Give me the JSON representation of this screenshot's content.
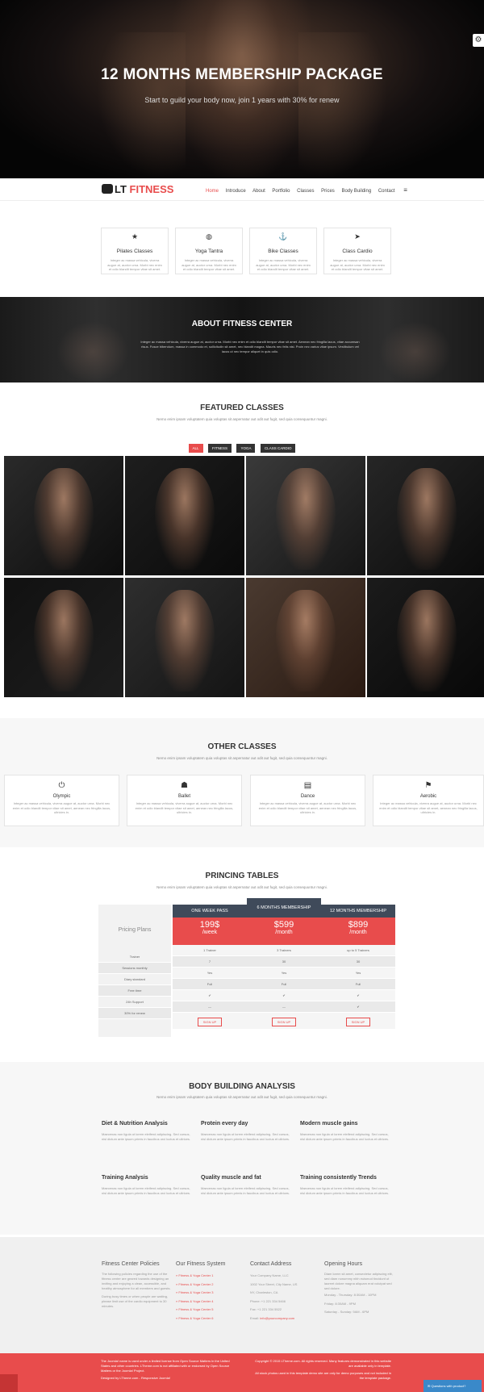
{
  "hero": {
    "title": "12 MONTHS MEMBERSHIP PACKAGE",
    "subtitle": "Start to guild your body now, join 1 years with 30% for renew",
    "gear": "⚙"
  },
  "nav": {
    "logo_prefix": "LT",
    "logo_accent": "FITNESS",
    "items": [
      "Home",
      "Introduce",
      "About",
      "Portfolio",
      "Classes",
      "Prices",
      "Body Building",
      "Contact"
    ],
    "menu_icon": "≡"
  },
  "services": [
    {
      "icon": "★",
      "title": "Pilates Classes",
      "text": "Integer ac massa vehicula, viverra augue at, auctor urna. Morbi nec enim et odio blandit tempor vitae sit amet."
    },
    {
      "icon": "◍",
      "title": "Yoga Tantra",
      "text": "Integer ac massa vehicula, viverra augue at, auctor urna. Morbi nec enim et odio blandit tempor vitae sit amet."
    },
    {
      "icon": "⚓",
      "title": "Bike Classes",
      "text": "Integer ac massa vehicula, viverra augue at, auctor urna. Morbi nec enim et odio blandit tempor vitae sit amet."
    },
    {
      "icon": "➤",
      "title": "Class Cardio",
      "text": "Integer ac massa vehicula, viverra augue at, auctor urna. Morbi nec enim et odio blandit tempor vitae sit amet."
    }
  ],
  "about": {
    "title": "ABOUT FITNESS CENTER",
    "text": "Integer ac massa vehicula, viverra augue at, auctor urna. Morbi nec enim et odio blandit tempor vitae sit amet. Aenean nec fringilla lacus, vitae accumsan risus. Fusce bibendum, massa in commodo et, sollicitudin sit amet, nec blandit magna. Mauris nec felis nisi. Proin nec varius vitae ipsum. Vestibulum vel lacus ut nec tempor aliquet in quis odio."
  },
  "featured": {
    "title": "FEATURED CLASSES",
    "subtitle": "Nemo enim ipsam voluptatem quia voluptas sit aspernatur aut odit aut fugit, sed quia consequuntur magni.",
    "filters": [
      "ALL",
      "FITNESS",
      "YOGA",
      "CLASS CARDIO"
    ]
  },
  "other": {
    "title": "OTHER CLASSES",
    "subtitle": "Nemo enim ipsam voluptatem quia voluptas sit aspernatur aut odit aut fugit, sed quia consequuntur magni.",
    "classes": [
      {
        "icon": "⏻",
        "title": "Olympic",
        "text": "Integer ac massa vehicula, viverra augue at, auctor urna. Morbi nec enim et odio blandit tempor vitae sit amet, aenean nec fringilla lacus, ultricies in."
      },
      {
        "icon": "☗",
        "title": "Ballet",
        "text": "Integer ac massa vehicula, viverra augue at, auctor urna. Morbi nec enim et odio blandit tempor vitae sit amet, aenean nec fringilla lacus, ultricies in."
      },
      {
        "icon": "▤",
        "title": "Dance",
        "text": "Integer ac massa vehicula, viverra augue at, auctor urna. Morbi nec enim et odio blandit tempor vitae sit amet, aenean nec fringilla lacus, ultricies in."
      },
      {
        "icon": "⚑",
        "title": "Aerobic",
        "text": "Integer ac massa vehicula, viverra augue at, auctor urna. Morbi nec enim et odio blandit tempor vitae sit amet, aenean nec fringilla lacus, ultricies in."
      }
    ]
  },
  "pricing": {
    "title": "PRINCING TABLES",
    "subtitle": "Nemo enim ipsam voluptatem quia voluptas sit aspernatur aut odit aut fugit, sed quia consequuntur magni.",
    "label": "Pricing Plans",
    "row_labels": [
      "Trainer",
      "Sessions monthly",
      "Diary standard",
      "Free time",
      "24h Support",
      "30% for renew"
    ],
    "plans": [
      {
        "name": "ONE WEEK PASS",
        "price": "199$",
        "period": "/week",
        "rows": [
          "1 Trainer",
          "7",
          "Yes",
          "Full",
          "✔",
          "—"
        ],
        "signup": "SIGN UP"
      },
      {
        "name": "6 MONTHS MEMBERSHIP",
        "price": "$599",
        "period": "/month",
        "rows": [
          "3 Trainers",
          "30",
          "Yes",
          "Full",
          "✔",
          "—"
        ],
        "signup": "SIGN UP"
      },
      {
        "name": "12 MONTHS MEMBERSHIP",
        "price": "$899",
        "period": "/month",
        "rows": [
          "up to 5 Trainers",
          "30",
          "Yes",
          "Full",
          "✔",
          "✔"
        ],
        "signup": "SIGN UP"
      }
    ]
  },
  "body_building": {
    "title": "BODY BUILDING ANALYSIS",
    "subtitle": "Nemo enim ipsam voluptatem quia voluptas sit aspernatur aut odit aut fugit, sed quia consequuntur magni.",
    "items": [
      {
        "title": "Diet & Nutrition Analysis",
        "text": "Maecenas non ligula ut lorem eleifend adipiscing. Sed cursus, nisl dictum ante ipsum primis in faucibus orci luctus et ultrices."
      },
      {
        "title": "Protein every day",
        "text": "Maecenas non ligula ut lorem eleifend adipiscing. Sed cursus, nisl dictum ante ipsum primis in faucibus orci luctus et ultrices."
      },
      {
        "title": "Modern muscle gains",
        "text": "Maecenas non ligula ut lorem eleifend adipiscing. Sed cursus, nisl dictum ante ipsum primis in faucibus orci luctus et ultrices."
      },
      {
        "title": "Training Analysis",
        "text": "Maecenas non ligula ut lorem eleifend adipiscing. Sed cursus, nisl dictum ante ipsum primis in faucibus orci luctus et ultrices."
      },
      {
        "title": "Quality muscle and fat",
        "text": "Maecenas non ligula ut lorem eleifend adipiscing. Sed cursus, nisl dictum ante ipsum primis in faucibus orci luctus et ultrices."
      },
      {
        "title": "Training consistently Trends",
        "text": "Maecenas non ligula ut lorem eleifend adipiscing. Sed cursus, nisl dictum ante ipsum primis in faucibus orci luctus et ultrices."
      }
    ]
  },
  "footer": {
    "policies_title": "Fitness Center Policies",
    "policies_text": "The following policies regarding the use of the fitness center are geared towards designing an inviting and enjoying a clean, accessible, and healthy atmosphere for all members and guests.",
    "policies_text2": "During busy times or when people are waiting, please limit use of the cardio equipment to 30 minutes.",
    "system_title": "Our Fitness System",
    "system_links": [
      "» Fitness & Yoga Center 1",
      "» Fitness & Yoga Center 2",
      "» Fitness & Yoga Center 3",
      "» Fitness & Yoga Center 4",
      "» Fitness & Yoga Center 5",
      "» Fitness & Yoga Center 6"
    ],
    "contact_title": "Contact Address",
    "contact_lines": [
      "Your Company Name, LLC",
      "1002 Your Street, City Name, US",
      "NY, Charleston, CA",
      "Phone: +1 221 334 5466",
      "Fax: +1 221 334 5522"
    ],
    "contact_email_label": "Email:",
    "contact_email": "info@yourcompany.com",
    "hours_title": "Opening Hours",
    "hours_text": "Diam lorem sit amet, consectetur adipiscing elit, sed diam nonummy nibh euismod tincidunt ut laoreet dolore magna aliquam erat volutpat sed sed dolore.",
    "hours_lines": [
      "Monday - Thursday: 8:30AM - 10PM",
      "Friday: 8:30AM - 9PM",
      "Saturday - Sunday: 9AM - 6PM"
    ]
  },
  "copyright": {
    "left": "The Joomla! name is used under a limited license from Open Source Matters in the United States and other countries. LTheme.com is not affiliated with or endorsed by Open Source Matters or the Joomla! Project.",
    "left2": "Designed by LTheme.com - Responsive Joomla!",
    "right": "Copyright © 2015 LTheme.com. All rights reserved. Many features demonstrated in this website are available only in template.",
    "right2": "All stock photos used in this template demo site are only for demo purposes and not included in the template package.",
    "help": "✉  Questions with product?"
  }
}
